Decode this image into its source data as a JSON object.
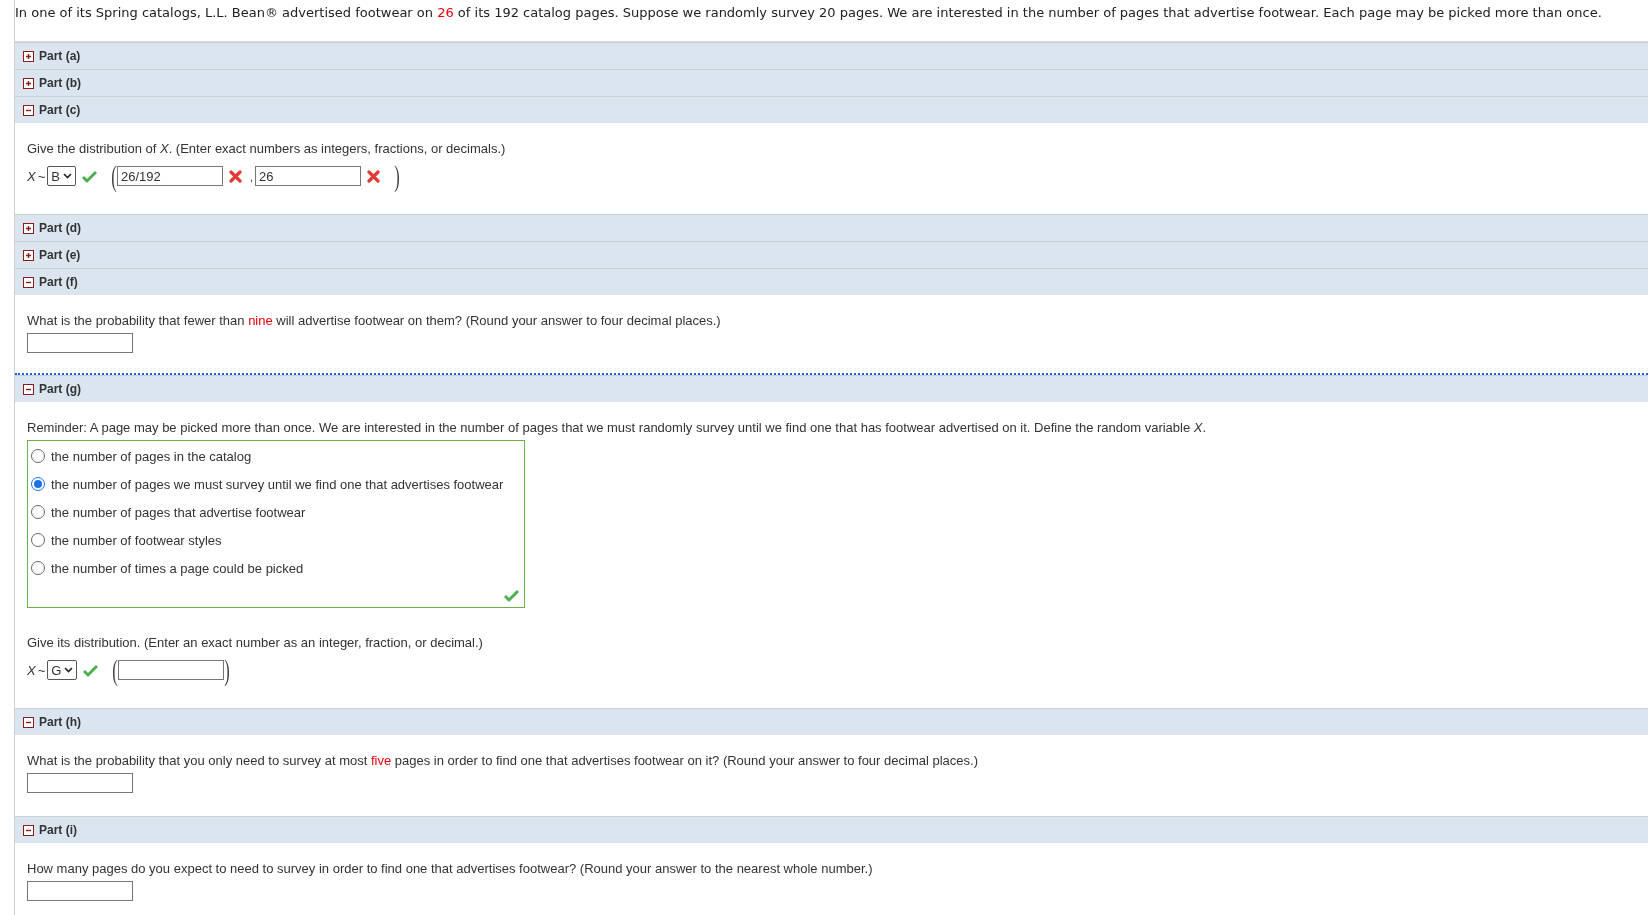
{
  "intro": {
    "segments": [
      {
        "text": "In one of its Spring catalogs, L.L. Bean® advertised footwear on ",
        "highlight": false
      },
      {
        "text": "26",
        "highlight": true
      },
      {
        "text": " of its 192 catalog pages. Suppose we randomly survey 20 pages. We are interested in the number of pages that advertise footwear. Each page may be picked more than once.",
        "highlight": false
      }
    ]
  },
  "parts": [
    {
      "label": "Part (a)",
      "expanded": false
    },
    {
      "label": "Part (b)",
      "expanded": false
    },
    {
      "label": "Part (c)",
      "expanded": true,
      "content": [
        {
          "kind": "prompt",
          "segments": [
            {
              "text": "Give the distribution of *X*. (Enter exact numbers as integers, fractions, or decimals.)",
              "highlight": false
            }
          ]
        },
        {
          "kind": "distribution",
          "variable": "X",
          "tilde": "~",
          "choice": "B",
          "choice_correct": true,
          "open": "(",
          "close": ")",
          "separator": ",",
          "params": [
            {
              "kind": "filled",
              "value": "26/192",
              "correct": false
            },
            {
              "kind": "filled",
              "value": "26",
              "correct": false
            }
          ]
        }
      ]
    },
    {
      "label": "Part (d)",
      "expanded": false
    },
    {
      "label": "Part (e)",
      "expanded": false
    },
    {
      "label": "Part (f)",
      "expanded": true,
      "content": [
        {
          "kind": "prompt",
          "segments": [
            {
              "text": "What is the probability that fewer than ",
              "highlight": false
            },
            {
              "text": "nine",
              "highlight": true
            },
            {
              "text": " will advertise footwear on them? (Round your answer to four decimal places.)",
              "highlight": false
            }
          ]
        },
        {
          "kind": "answer_field"
        },
        {
          "kind": "dotted_rule"
        }
      ]
    },
    {
      "label": "Part (g)",
      "expanded": true,
      "content": [
        {
          "kind": "prompt",
          "segments": [
            {
              "text": "Reminder: A page may be picked more than once. We are interested in the number of pages that we must randomly survey until we find one that has footwear advertised on it. Define the random variable *X*.",
              "highlight": false
            }
          ]
        },
        {
          "kind": "choices",
          "correct": true,
          "options": [
            {
              "label": "the number of pages in the catalog",
              "selected": false
            },
            {
              "label": "the number of pages we must survey until we find one that advertises footwear",
              "selected": true
            },
            {
              "label": "the number of pages that advertise footwear",
              "selected": false
            },
            {
              "label": "the number of footwear styles",
              "selected": false
            },
            {
              "label": "the number of times a page could be picked",
              "selected": false
            }
          ]
        },
        {
          "kind": "prompt",
          "segments": [
            {
              "text": "Give its distribution. (Enter an exact number as an integer, fraction, or decimal.)",
              "highlight": false
            }
          ]
        },
        {
          "kind": "distribution",
          "variable": "X",
          "tilde": "~",
          "choice": "G",
          "choice_correct": true,
          "open": "(",
          "close": ")",
          "params": [
            {
              "kind": "blank"
            }
          ]
        }
      ]
    },
    {
      "label": "Part (h)",
      "expanded": true,
      "content": [
        {
          "kind": "prompt",
          "segments": [
            {
              "text": "What is the probability that you only need to survey at most ",
              "highlight": false
            },
            {
              "text": "five",
              "highlight": true
            },
            {
              "text": " pages in order to find one that advertises footwear on it? (Round your answer to four decimal places.)",
              "highlight": false
            }
          ]
        },
        {
          "kind": "answer_field"
        }
      ]
    },
    {
      "label": "Part (i)",
      "expanded": true,
      "content": [
        {
          "kind": "prompt",
          "segments": [
            {
              "text": "How many pages do you expect to need to survey in order to find one that advertises footwear? (Round your answer to the nearest whole number.)",
              "highlight": false
            }
          ]
        },
        {
          "kind": "answer_field"
        }
      ]
    }
  ]
}
